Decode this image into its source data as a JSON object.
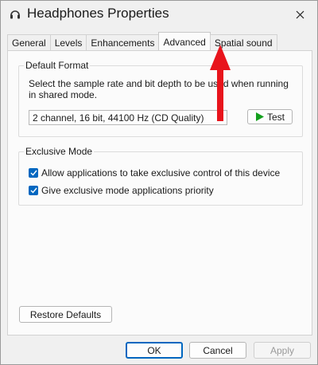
{
  "window": {
    "title": "Headphones Properties",
    "icon": "headphones-icon",
    "close_label": "✕"
  },
  "tabs": [
    {
      "label": "General",
      "active": false
    },
    {
      "label": "Levels",
      "active": false
    },
    {
      "label": "Enhancements",
      "active": false
    },
    {
      "label": "Advanced",
      "active": true
    },
    {
      "label": "Spatial sound",
      "active": false
    }
  ],
  "default_format": {
    "group_label": "Default Format",
    "description": "Select the sample rate and bit depth to be used when running in shared mode.",
    "selected_format": "2 channel, 16 bit, 44100 Hz (CD Quality)",
    "test_button": "Test"
  },
  "exclusive_mode": {
    "group_label": "Exclusive Mode",
    "options": [
      {
        "label": "Allow applications to take exclusive control of this device",
        "checked": true
      },
      {
        "label": "Give exclusive mode applications priority",
        "checked": true
      }
    ]
  },
  "restore_defaults": "Restore Defaults",
  "footer": {
    "ok": "OK",
    "cancel": "Cancel",
    "apply": "Apply"
  },
  "colors": {
    "accent": "#0067c0",
    "annotation_arrow": "#e8141c",
    "play_icon": "#14a01e"
  }
}
